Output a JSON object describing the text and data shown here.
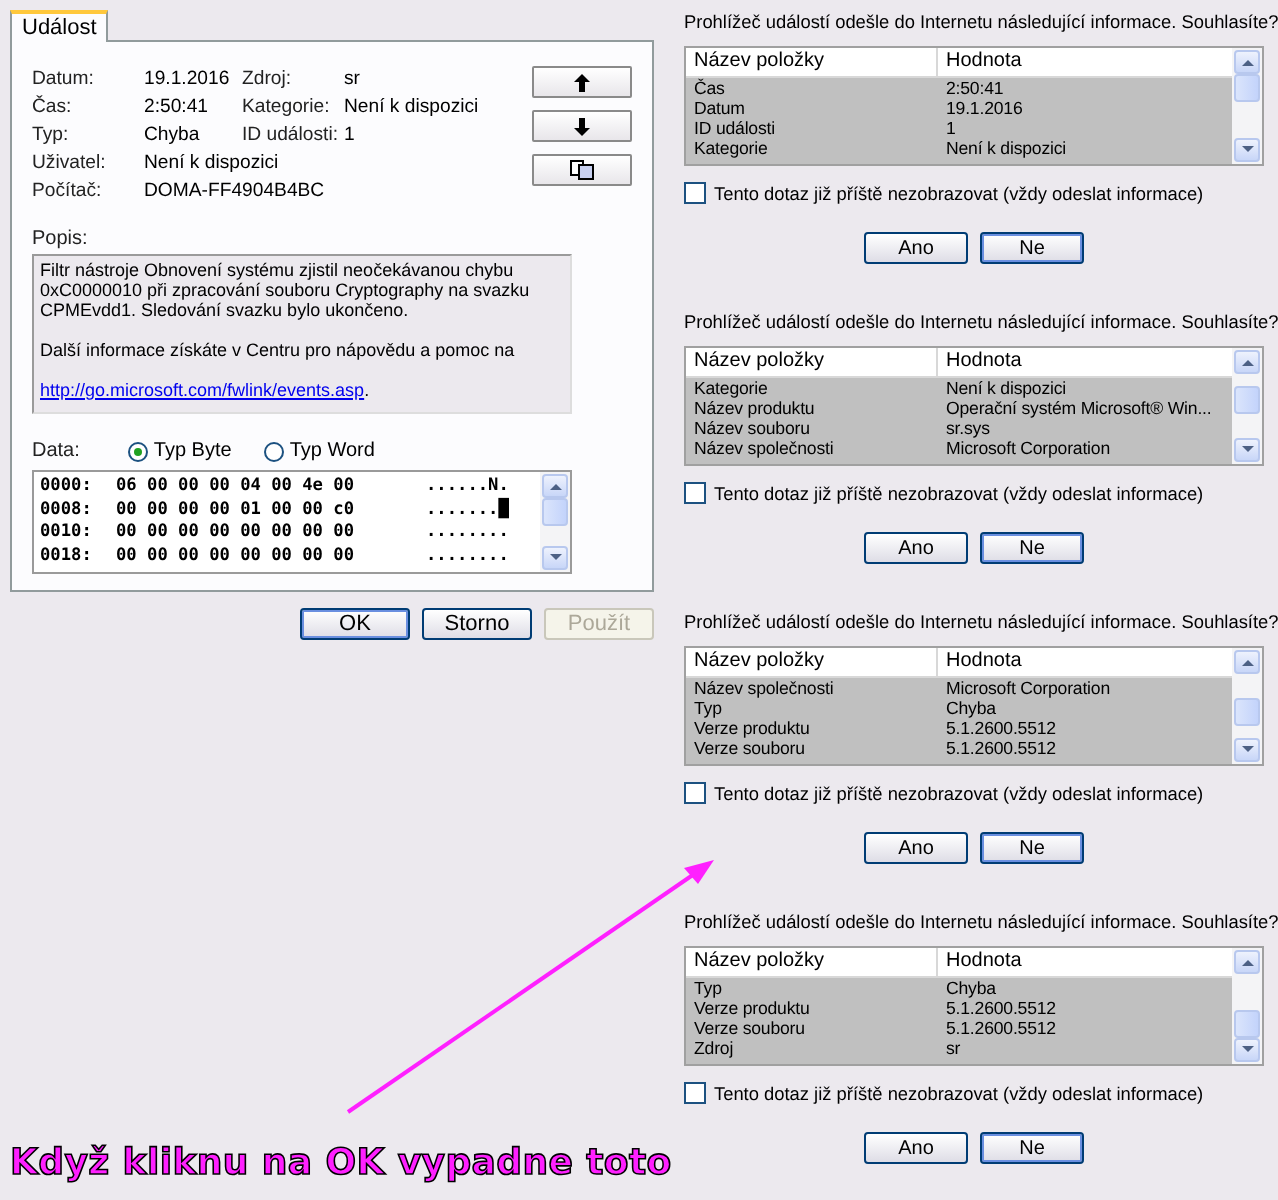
{
  "event_properties": {
    "tab": {
      "label": "Událost",
      "selected": true
    },
    "field_rows": [
      [
        {
          "label": "Datum:",
          "value": "19.1.2016"
        },
        {
          "label": "Zdroj:",
          "value": "sr"
        }
      ],
      [
        {
          "label": "Čas:",
          "value": "2:50:41"
        },
        {
          "label": "Kategorie:",
          "value": "Není k dispozici"
        }
      ],
      [
        {
          "label": "Typ:",
          "value": "Chyba"
        },
        {
          "label": "ID události:",
          "value": "1"
        }
      ],
      [
        {
          "label": "Uživatel:",
          "value": "Není k dispozici"
        }
      ],
      [
        {
          "label": "Počítač:",
          "value": "DOMA-FF4904B4BC"
        }
      ]
    ],
    "nav_buttons": [
      {
        "kind": "up"
      },
      {
        "kind": "down"
      },
      {
        "kind": "copy"
      }
    ],
    "description": {
      "label": "Popis:",
      "text": "Filtr nástroje Obnovení systému zjistil neočekávanou chybu 0xC0000010 při zpracování souboru Cryptography na svazku CPMEvdd1.  Sledování svazku bylo ukončeno.",
      "more": "Další informace získáte v Centru pro nápovědu a pomoc na",
      "link": "http://go.microsoft.com/fwlink/events.asp",
      "link_tail": "."
    },
    "data": {
      "label": "Data:",
      "radios": [
        {
          "label": "Typ Byte",
          "selected": true
        },
        {
          "label": "Typ Word",
          "selected": false
        }
      ],
      "lines": [
        {
          "offset": "0000:",
          "bytes": "06 00 00 00 04 00 4e 00",
          "ascii": "......N."
        },
        {
          "offset": "0008:",
          "bytes": "00 00 00 00 01 00 00 c0",
          "ascii": ".......█"
        },
        {
          "offset": "0010:",
          "bytes": "00 00 00 00 00 00 00 00",
          "ascii": "........"
        },
        {
          "offset": "0018:",
          "bytes": "00 00 00 00 00 00 00 00",
          "ascii": "........"
        }
      ]
    },
    "buttons": [
      {
        "label": "OK",
        "default": true,
        "disabled": false
      },
      {
        "label": "Storno",
        "default": false,
        "disabled": false
      },
      {
        "label": "Použít",
        "default": false,
        "disabled": true
      }
    ]
  },
  "dialogs": [
    {
      "prompt": "Prohlížeč událostí odešle do Internetu následující informace. Souhlasíte?",
      "columns": [
        "Název položky",
        "Hodnota"
      ],
      "rows": [
        {
          "name": "Čas",
          "value": "2:50:41"
        },
        {
          "name": "Datum",
          "value": "19.1.2016"
        },
        {
          "name": "ID události",
          "value": "1"
        },
        {
          "name": "Kategorie",
          "value": "Není k dispozici"
        }
      ],
      "checkbox": {
        "label": "Tento dotaz již příště nezobrazovat (vždy odeslat informace)",
        "checked": false
      },
      "buttons": [
        "Ano",
        "Ne"
      ]
    },
    {
      "prompt": "Prohlížeč událostí odešle do Internetu následující informace. Souhlasíte?",
      "columns": [
        "Název položky",
        "Hodnota"
      ],
      "rows": [
        {
          "name": "Kategorie",
          "value": "Není k dispozici"
        },
        {
          "name": "Název produktu",
          "value": "Operační systém Microsoft® Win..."
        },
        {
          "name": "Název souboru",
          "value": "sr.sys"
        },
        {
          "name": "Název společnosti",
          "value": "Microsoft Corporation"
        }
      ],
      "checkbox": {
        "label": "Tento dotaz již příště nezobrazovat (vždy odeslat informace)",
        "checked": false
      },
      "buttons": [
        "Ano",
        "Ne"
      ]
    },
    {
      "prompt": "Prohlížeč událostí odešle do Internetu následující informace. Souhlasíte?",
      "columns": [
        "Název položky",
        "Hodnota"
      ],
      "rows": [
        {
          "name": "Název společnosti",
          "value": "Microsoft Corporation"
        },
        {
          "name": "Typ",
          "value": "Chyba"
        },
        {
          "name": "Verze produktu",
          "value": "5.1.2600.5512"
        },
        {
          "name": "Verze souboru",
          "value": "5.1.2600.5512"
        }
      ],
      "checkbox": {
        "label": "Tento dotaz již příště nezobrazovat (vždy odeslat informace)",
        "checked": false
      },
      "buttons": [
        "Ano",
        "Ne"
      ]
    },
    {
      "prompt": "Prohlížeč událostí odešle do Internetu následující informace. Souhlasíte?",
      "columns": [
        "Název položky",
        "Hodnota"
      ],
      "rows": [
        {
          "name": "Typ",
          "value": "Chyba"
        },
        {
          "name": "Verze produktu",
          "value": "5.1.2600.5512"
        },
        {
          "name": "Verze souboru",
          "value": "5.1.2600.5512"
        },
        {
          "name": "Zdroj",
          "value": "sr"
        }
      ],
      "checkbox": {
        "label": "Tento dotaz již příště nezobrazovat (vždy odeslat informace)",
        "checked": false
      },
      "buttons": [
        "Ano",
        "Ne"
      ]
    }
  ],
  "annotation": {
    "text": "Když kliknu na OK vypadne toto"
  }
}
